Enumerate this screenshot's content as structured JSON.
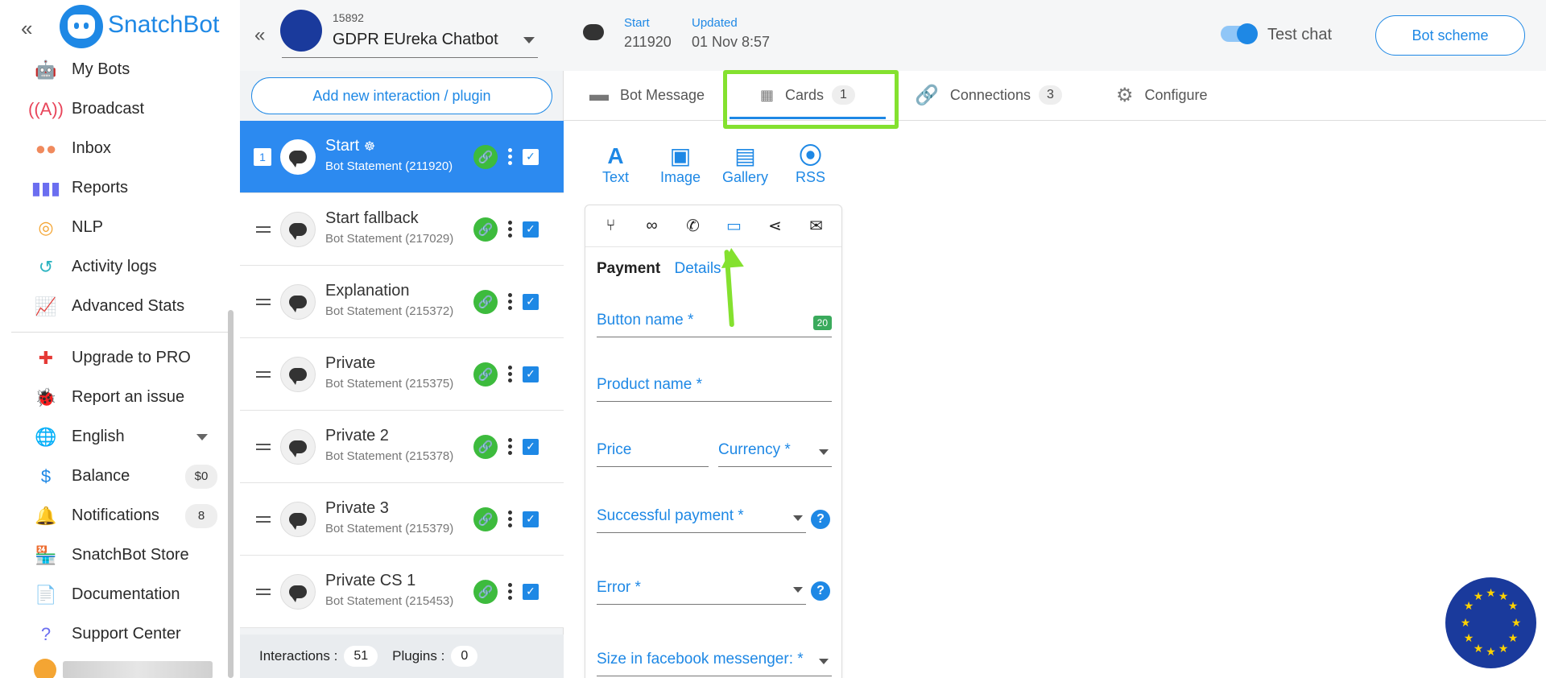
{
  "nav": {
    "brand": "SnatchBot",
    "items": [
      {
        "label": "My Bots",
        "icon": "robot-icon",
        "color": "#3a9ad9"
      },
      {
        "label": "Broadcast",
        "icon": "broadcast-icon",
        "color": "#e8455a"
      },
      {
        "label": "Inbox",
        "icon": "chat-bubbles-icon",
        "color": "#f08a5d"
      },
      {
        "label": "Reports",
        "icon": "bar-chart-icon",
        "color": "#6b6ef0"
      },
      {
        "label": "NLP",
        "icon": "coins-icon",
        "color": "#f4a533"
      },
      {
        "label": "Activity logs",
        "icon": "history-icon",
        "color": "#2bb3c0"
      },
      {
        "label": "Advanced Stats",
        "icon": "line-chart-icon",
        "color": "#d65aa0"
      }
    ],
    "items2": [
      {
        "label": "Upgrade to PRO",
        "icon": "plus-circle-icon",
        "color": "#e53935"
      },
      {
        "label": "Report an issue",
        "icon": "bug-icon",
        "color": "#333333"
      },
      {
        "label": "English",
        "icon": "globe-icon",
        "color": "#26a0da"
      },
      {
        "label": "Balance",
        "icon": "dollar-icon",
        "color": "#1e88e5",
        "badge": "$0"
      },
      {
        "label": "Notifications",
        "icon": "bell-icon",
        "color": "#ec407a",
        "badge": "8"
      },
      {
        "label": "SnatchBot Store",
        "icon": "store-icon",
        "color": "#f08a5d"
      },
      {
        "label": "Documentation",
        "icon": "document-icon",
        "color": "#1e88e5"
      },
      {
        "label": "Support Center",
        "icon": "help-icon",
        "color": "#6b6ef0"
      }
    ]
  },
  "bot": {
    "id": "15892",
    "name": "GDPR EUreka Chatbot"
  },
  "list": {
    "add_label": "Add new interaction / plugin",
    "active_number": "1",
    "items": [
      {
        "title": "Start",
        "sub": "Bot Statement (211920)"
      },
      {
        "title": "Start fallback",
        "sub": "Bot Statement (217029)"
      },
      {
        "title": "Explanation",
        "sub": "Bot Statement (215372)"
      },
      {
        "title": "Private",
        "sub": "Bot Statement (215375)"
      },
      {
        "title": "Private 2",
        "sub": "Bot Statement (215378)"
      },
      {
        "title": "Private 3",
        "sub": "Bot Statement (215379)"
      },
      {
        "title": "Private CS 1",
        "sub": "Bot Statement (215453)"
      }
    ],
    "footer": {
      "interactions_label": "Interactions :",
      "interactions": "51",
      "plugins_label": "Plugins :",
      "plugins": "0"
    }
  },
  "header": {
    "start_label": "Start",
    "start_value": "211920",
    "updated_label": "Updated",
    "updated_value": "01 Nov 8:57",
    "test_chat": "Test chat",
    "bot_scheme": "Bot scheme"
  },
  "tabs": [
    {
      "label": "Bot Message",
      "icon": "message-icon"
    },
    {
      "label": "Cards",
      "icon": "grid-icon",
      "count": "1"
    },
    {
      "label": "Connections",
      "icon": "link-icon",
      "count": "3"
    },
    {
      "label": "Configure",
      "icon": "gear-icon"
    }
  ],
  "card_types": [
    {
      "label": "Text",
      "icon": "text-icon"
    },
    {
      "label": "Image",
      "icon": "image-icon"
    },
    {
      "label": "Gallery",
      "icon": "gallery-icon"
    },
    {
      "label": "RSS",
      "icon": "rss-icon"
    }
  ],
  "card": {
    "tools": [
      "branch-icon",
      "link-icon",
      "phone-icon",
      "card-icon",
      "share-icon",
      "mail-icon"
    ],
    "selected_tool": "card-icon",
    "tab_payment": "Payment",
    "tab_details": "Details",
    "button_name": "Button name *",
    "button_name_remaining": "20",
    "product_name": "Product name *",
    "price": "Price",
    "currency": "Currency *",
    "successful_payment": "Successful payment *",
    "error": "Error *",
    "size": "Size in facebook messenger: *"
  },
  "colors": {
    "accent": "#1e88e5",
    "highlight": "#84e12f",
    "link_green": "#3dbb3d"
  }
}
